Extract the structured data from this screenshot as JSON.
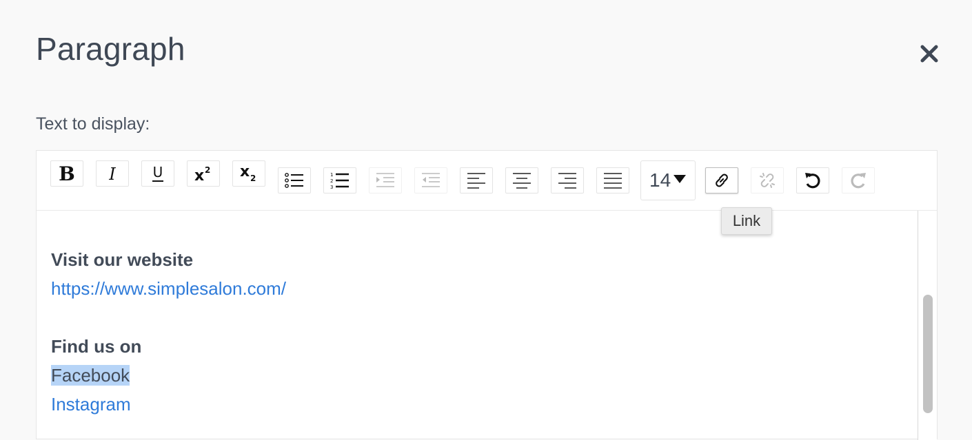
{
  "dialog": {
    "title": "Paragraph",
    "field_label": "Text to display:"
  },
  "toolbar": {
    "font_size": "14",
    "tooltip": "Link",
    "buttons": [
      "bold",
      "italic",
      "underline",
      "superscript",
      "subscript",
      "bullet-list",
      "numbered-list",
      "indent",
      "outdent",
      "align-left",
      "align-center",
      "align-right",
      "justify",
      "font-size",
      "link",
      "unlink",
      "undo",
      "redo"
    ]
  },
  "content": {
    "heading1": "Visit our website",
    "url": "https://www.simplesalon.com/",
    "heading2": "Find us on",
    "link1": "Facebook",
    "link2": "Instagram"
  },
  "colors": {
    "link": "#2f7bd9",
    "selection": "#b6d4f7",
    "text": "#424b58"
  }
}
